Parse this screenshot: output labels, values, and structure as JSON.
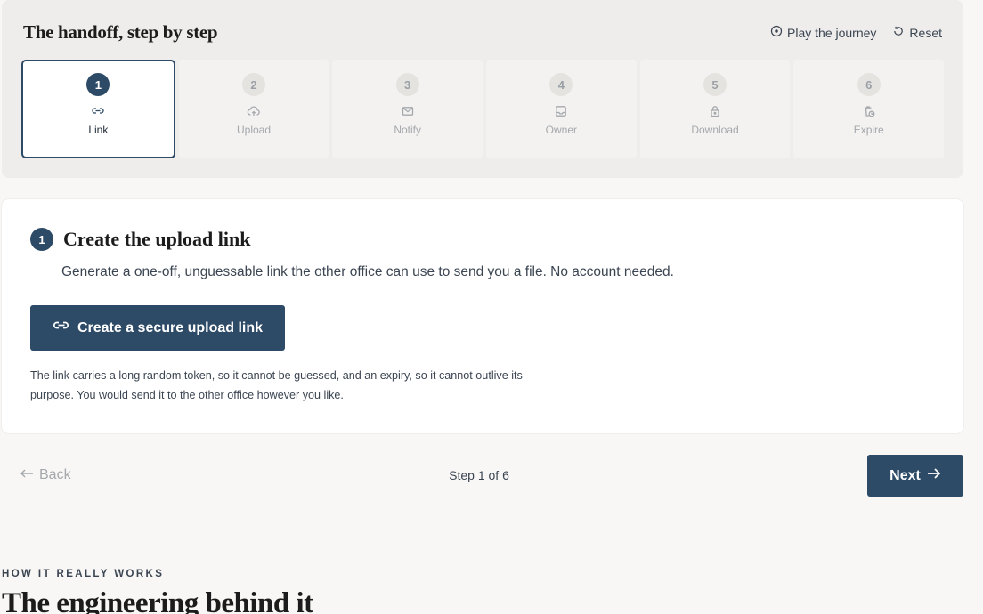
{
  "stepper": {
    "title": "The handoff, step by step",
    "play_label": "Play the journey",
    "reset_label": "Reset",
    "steps": [
      {
        "num": "1",
        "label": "Link",
        "icon": "link-icon"
      },
      {
        "num": "2",
        "label": "Upload",
        "icon": "cloud-upload-icon"
      },
      {
        "num": "3",
        "label": "Notify",
        "icon": "mail-icon"
      },
      {
        "num": "4",
        "label": "Owner",
        "icon": "inbox-icon"
      },
      {
        "num": "5",
        "label": "Download",
        "icon": "lock-icon"
      },
      {
        "num": "6",
        "label": "Expire",
        "icon": "trash-clock-icon"
      }
    ],
    "active_step": 1
  },
  "card": {
    "step_num": "1",
    "title": "Create the upload link",
    "description": "Generate a one-off, unguessable link the other office can use to send you a file. No account needed.",
    "button_label": "Create a secure upload link",
    "note": "The link carries a long random token, so it cannot be guessed, and an expiry, so it cannot outlive its purpose. You would send it to the other office however you like."
  },
  "nav": {
    "back_label": "Back",
    "step_count": "Step 1 of 6",
    "next_label": "Next"
  },
  "section": {
    "eyebrow": "HOW IT REALLY WORKS",
    "title": "The engineering behind it"
  },
  "colors": {
    "accent": "#2d4a66",
    "background": "#f8f7f5",
    "panel": "#eeedeb"
  }
}
